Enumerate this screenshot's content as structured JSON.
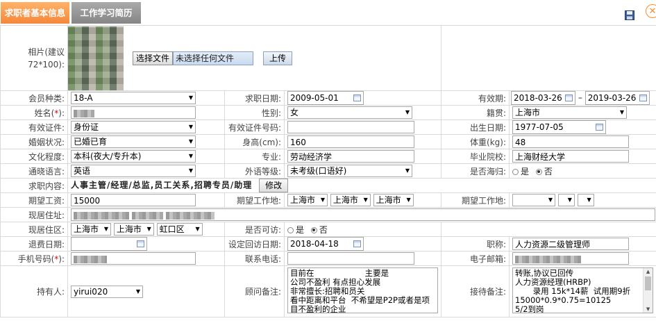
{
  "tabs": {
    "active": "求职者基本信息",
    "inactive": "工作学习简历"
  },
  "photo": {
    "label": "相片(建议72*100):",
    "file_button": "选择文件",
    "file_status": "未选择任何文件",
    "upload": "上传"
  },
  "row1": {
    "member_label": "会员种类:",
    "member_value": "18-A",
    "apply_label": "求职日期:",
    "apply_date": "2009-05-01",
    "valid_label": "有效期:",
    "valid_from": "2018-03-26",
    "valid_sep": "–",
    "valid_to": "2019-03-26"
  },
  "row2": {
    "name_label": "姓名",
    "gender_label": "性别:",
    "gender_value": "女",
    "native_label": "籍贯:",
    "native_value": "上海市"
  },
  "row3": {
    "id_label": "有效证件:",
    "id_value": "身份证",
    "idno_label": "有效证件号码:",
    "birth_label": "出生日期:",
    "birth_value": "1977-07-05"
  },
  "row4": {
    "marital_label": "婚姻状况:",
    "marital_value": "已婚已育",
    "height_label": "身高(cm):",
    "height_value": "160",
    "weight_label": "体重(kg):",
    "weight_value": "48"
  },
  "row5": {
    "edu_label": "文化程度:",
    "edu_value": "本科(夜大/专升本)",
    "major_label": "专业:",
    "major_value": "劳动经济学",
    "school_label": "毕业院校:",
    "school_value": "上海财经大学"
  },
  "row6": {
    "lang_label": "通晓语言:",
    "lang_value": "英语",
    "level_label": "外语等级:",
    "level_value": "未考级(口语好)",
    "overseas_label": "是否海归:",
    "yes": "是",
    "no": "否"
  },
  "row7": {
    "content_label": "求职内容:",
    "content_value": "人事主管/经理/总监,员工关系,招聘专员/助理",
    "modify": "修改"
  },
  "row8": {
    "salary_label": "期望工资:",
    "salary_value": "15000",
    "loc_label": "期望工作地:",
    "loc1": "上海市",
    "loc2": "上海市",
    "loc3": "上海市",
    "loc2_label": "期望工作地:"
  },
  "row9": {
    "addr_label": "现居住址:"
  },
  "row10": {
    "area_label": "现居住区:",
    "area1": "上海市",
    "area2": "上海市",
    "area3": "虹口区",
    "visit_label": "是否可访:",
    "yes": "是",
    "no": "否"
  },
  "row11": {
    "refund_label": "退费日期:",
    "revisit_label": "设定回访日期:",
    "revisit_value": "2018-04-18",
    "title_label": "职称:",
    "title_value": "人力资源二级管理师"
  },
  "row12": {
    "phone_label": "手机号码",
    "tel_label": "联系电话:",
    "email_label": "电子邮箱:"
  },
  "row13": {
    "holder_label": "持有人:",
    "holder_value": "yirui020",
    "note_label": "顾问备注:",
    "note_text": "目前在                    主要是\n公司不盈利 有点担心发展\n非常擅长:招聘和员关\n看中距离和平台  不希望是P2P或者是项\n目不盈利的企业",
    "recv_label": "接待备注:",
    "recv_text": "转账,协议已回传\n人力资源经理(HRBP)\n       录用 15k*14薪  试用期9折\n15000*0.9*0.75=10125\n5/2到岗"
  }
}
